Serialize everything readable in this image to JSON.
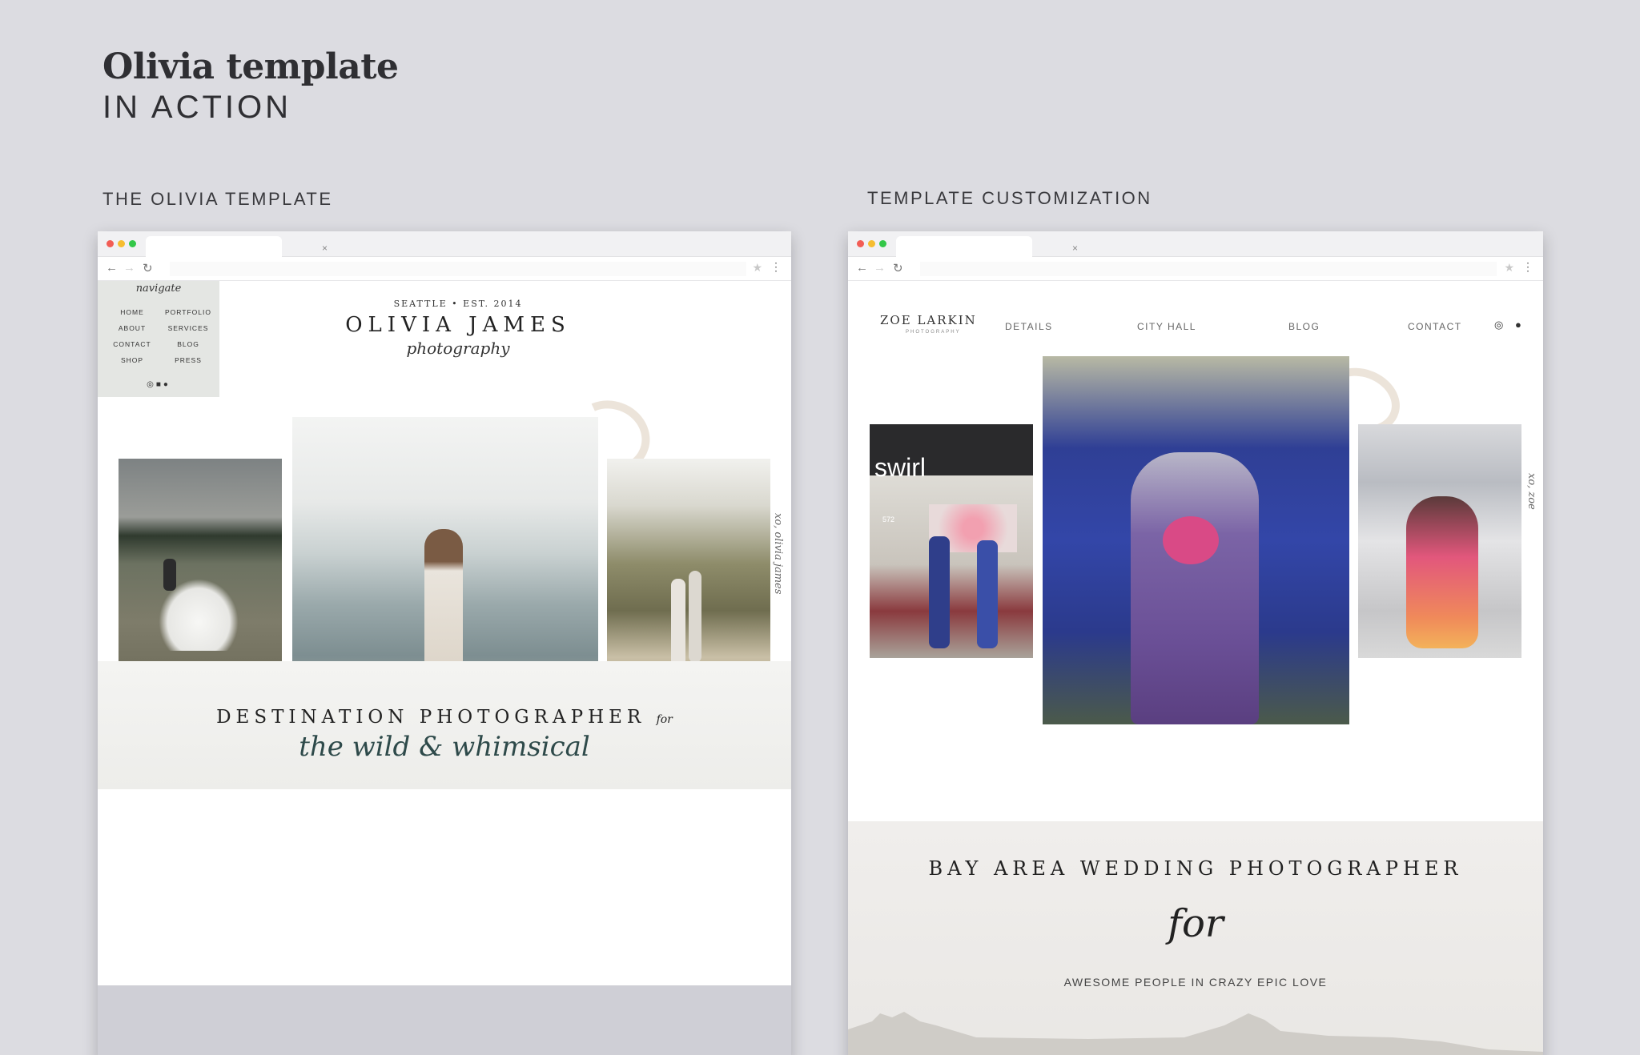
{
  "header": {
    "title": "Olivia template",
    "subtitle": "IN ACTION"
  },
  "sections": {
    "left_label": "THE OLIVIA TEMPLATE",
    "right_label": "TEMPLATE CUSTOMIZATION"
  },
  "browser": {
    "tab_close": "×"
  },
  "olivia_site": {
    "nav_script": "navigate",
    "nav_items": [
      "HOME",
      "PORTFOLIO",
      "ABOUT",
      "SERVICES",
      "CONTACT",
      "BLOG",
      "SHOP",
      "PRESS"
    ],
    "social_icons": [
      "instagram-icon",
      "facebook-icon",
      "pinterest-icon"
    ],
    "brand_top": "SEATTLE • EST. 2014",
    "brand_name": "OLIVIA JAMES",
    "brand_script": "photography",
    "side_script": "xo, olivia james",
    "tagline": "DESTINATION PHOTOGRAPHER",
    "tagline_for": "for",
    "tagline_script": "the wild & whimsical"
  },
  "zoe_site": {
    "logo": "ZOE LARKIN",
    "logo_sub": "PHOTOGRAPHY",
    "nav_items": [
      "DETAILS",
      "CITY HALL",
      "BLOG",
      "CONTACT"
    ],
    "social_icons": [
      "instagram-icon",
      "pinterest-icon"
    ],
    "side_script": "xo, zoe",
    "storefront_sign": "swirl",
    "storefront_number": "572",
    "tagline": "BAY AREA WEDDING PHOTOGRAPHER",
    "tagline_for": "for",
    "tagline_sub": "AWESOME PEOPLE IN CRAZY EPIC LOVE"
  }
}
